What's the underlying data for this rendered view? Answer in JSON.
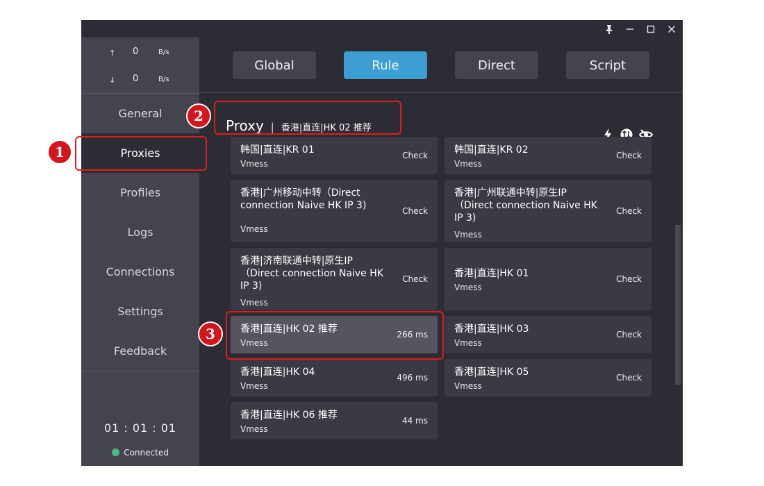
{
  "speed": {
    "up": {
      "arrow": "↑",
      "value": "0",
      "unit": "B/s"
    },
    "down": {
      "arrow": "↓",
      "value": "0",
      "unit": "B/s"
    }
  },
  "nav": [
    "General",
    "Proxies",
    "Profiles",
    "Logs",
    "Connections",
    "Settings",
    "Feedback"
  ],
  "timer": "01 : 01 : 01",
  "status": "Connected",
  "modes": [
    "Global",
    "Rule",
    "Direct",
    "Script"
  ],
  "group": {
    "name": "Proxy",
    "sep": "|",
    "current": "香港|直连|HK 02 推荐"
  },
  "proxies": [
    {
      "name": "韩国|直连|KR 01",
      "type": "Vmess",
      "status": "Check"
    },
    {
      "name": "韩国|直连|KR 02",
      "type": "Vmess",
      "status": "Check"
    },
    {
      "name": "香港|广州移动中转（Direct connection Naive HK IP 3)",
      "type": "Vmess",
      "status": "Check"
    },
    {
      "name": "香港|广州联通中转|原生IP （Direct connection Naive HK IP 3)",
      "type": "Vmess",
      "status": "Check"
    },
    {
      "name": "香港|济南联通中转|原生IP （Direct connection Naive HK IP 3)",
      "type": "Vmess",
      "status": "Check"
    },
    {
      "name": "香港|直连|HK 01",
      "type": "Vmess",
      "status": "Check"
    },
    {
      "name": "香港|直连|HK 02 推荐",
      "type": "Vmess",
      "status": "266 ms"
    },
    {
      "name": "香港|直连|HK 03",
      "type": "Vmess",
      "status": "Check"
    },
    {
      "name": "香港|直连|HK 04",
      "type": "Vmess",
      "status": "496 ms"
    },
    {
      "name": "香港|直连|HK 05",
      "type": "Vmess",
      "status": "Check"
    },
    {
      "name": "香港|直连|HK 06 推荐",
      "type": "Vmess",
      "status": "44 ms"
    }
  ],
  "annotations": [
    "1",
    "2",
    "3"
  ],
  "colors": {
    "accent": "#3c9ed1",
    "annotation": "#e11b22",
    "connected": "#4cb882"
  }
}
